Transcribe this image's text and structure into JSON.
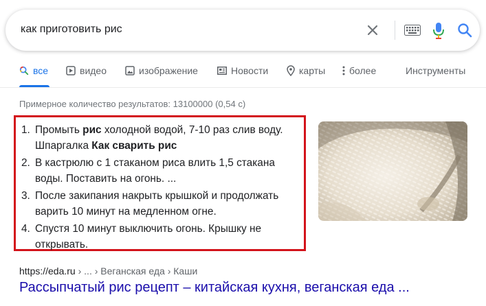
{
  "search": {
    "query": "как приготовить рис"
  },
  "icons": {
    "clear": "close-icon",
    "keyboard": "keyboard-icon",
    "mic": "microphone-icon",
    "search": "search-icon"
  },
  "colors": {
    "accent": "#1a73e8",
    "link": "#1a0dab",
    "highlight_border": "#d3131a"
  },
  "tabs": [
    {
      "label": "все",
      "active": true
    },
    {
      "label": "видео"
    },
    {
      "label": "изображение"
    },
    {
      "label": "Новости"
    },
    {
      "label": "карты"
    },
    {
      "label": "более"
    },
    {
      "label": "Инструменты"
    }
  ],
  "stats": "Примерное количество результатов: 13100000 (0,54 с)",
  "snippet": {
    "steps": [
      {
        "num": "1.",
        "t1": "Промыть ",
        "b1": "рис",
        "t2": " холодной водой, 7-10 раз слив воду. Шпаргалка ",
        "b2": "Как сварить рис",
        "t3": ""
      },
      {
        "num": "2.",
        "t1": "В кастрюлю с 1 стаканом риса влить 1,5 стакана воды. Поставить на огонь. ...",
        "b1": "",
        "t2": "",
        "b2": "",
        "t3": ""
      },
      {
        "num": "3.",
        "t1": "После закипания накрыть крышкой и продолжать варить 10 минут на медленном огне.",
        "b1": "",
        "t2": "",
        "b2": "",
        "t3": ""
      },
      {
        "num": "4.",
        "t1": "Спустя 10 минут выключить огонь. Крышку не открывать.",
        "b1": "",
        "t2": "",
        "b2": "",
        "t3": ""
      }
    ]
  },
  "result": {
    "domain": "https://eda.ru",
    "breadcrumb": " › ... › Веганская еда › Каши",
    "title": "Рассыпчатый рис рецепт – китайская кухня, веганская еда ..."
  }
}
